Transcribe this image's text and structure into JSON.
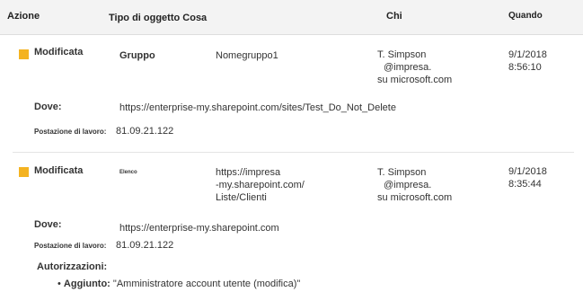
{
  "header": {
    "azione": "Azione",
    "tipo_cosa": "Tipo di oggetto Cosa",
    "chi": "Chi",
    "quando": "Quando"
  },
  "entries": [
    {
      "action": "Modificata",
      "type": "Gruppo",
      "what": "Nomegruppo1",
      "who": [
        "T. Simpson",
        "@impresa.",
        "su microsoft.com"
      ],
      "when": [
        "9/1/2018",
        "8:56:10"
      ],
      "where_label": "Dove:",
      "where": "https://enterprise-my.sharepoint.com/sites/Test_Do_Not_Delete",
      "workstation_label": "Postazione di lavoro:",
      "workstation": "81.09.21.122"
    },
    {
      "action": "Modificata",
      "type": "Elenco",
      "what": [
        "https://impresa",
        "-my.sharepoint.com/",
        "Liste/Clienti"
      ],
      "who": [
        "T. Simpson",
        "@impresa.",
        "su microsoft.com"
      ],
      "when": [
        "9/1/2018",
        "8:35:44"
      ],
      "where_label": "Dove:",
      "where": "https://enterprise-my.sharepoint.com",
      "workstation_label": "Postazione di lavoro:",
      "workstation": "81.09.21.122",
      "permissions_label": "Autorizzazioni:",
      "permission_bullet": "•",
      "permission_key": "Aggiunto:",
      "permission_value": "\"Amministratore account utente (modifica)\""
    }
  ],
  "colors": {
    "marker": "#f4b321",
    "header_bg": "#f3f3f3"
  }
}
